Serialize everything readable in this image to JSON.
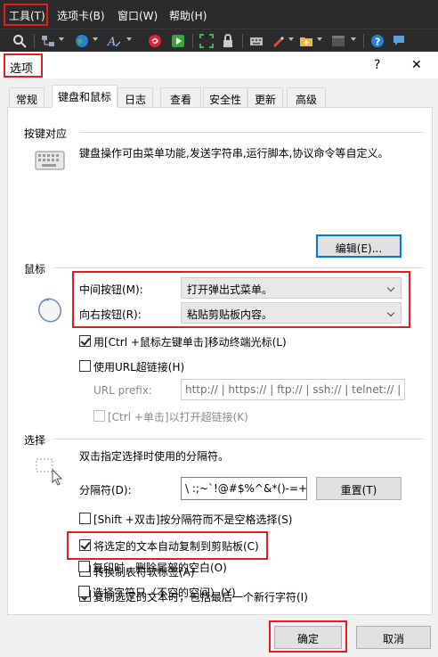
{
  "menubar": {
    "items": [
      "工具(T)",
      "选项卡(B)",
      "窗口(W)",
      "帮助(H)"
    ]
  },
  "toolbar": {
    "icons": [
      "search-icon",
      "network-icon",
      "globe-icon",
      "font-icon",
      "swirl-icon",
      "play-icon",
      "expand-icon",
      "lock-icon",
      "keyboard-icon",
      "pen-icon",
      "add-folder-icon",
      "window-icon",
      "help-icon",
      "chat-icon"
    ]
  },
  "dialog": {
    "title": "选项",
    "help": "?",
    "close": "✕",
    "tabs": [
      "常规",
      "键盘和鼠标",
      "日志",
      "查看",
      "安全性",
      "更新",
      "高级"
    ],
    "active_tab": "键盘和鼠标",
    "keymap": {
      "group": "按键对应",
      "desc": "键盘操作可由菜单功能,发送字符串,运行脚本,协议命令等自定义。",
      "edit_button": "编辑(E)..."
    },
    "mouse": {
      "group": "鼠标",
      "middle_label": "中间按钮(M):",
      "middle_value": "打开弹出式菜单。",
      "right_label": "向右按钮(R):",
      "right_value": "粘贴剪贴板内容。",
      "ctrl_click": "用[Ctrl +鼠标左键单击]移动终端光标(L)",
      "ctrl_click_checked": true,
      "use_url": "使用URL超链接(H)",
      "use_url_checked": false,
      "url_prefix_label": "URL prefix:",
      "url_prefix_value": "http:// | https:// | ftp:// | ssh:// | telnet:// |",
      "ctrl_open": "[Ctrl +单击]以打开超链接(K)",
      "ctrl_open_checked": false
    },
    "selection": {
      "group": "选择",
      "desc": "双击指定选择时使用的分隔符。",
      "delim_label": "分隔符(D):",
      "delim_value": "\\ :;~`!@#$%^&*()-=+|[",
      "reset_button": "重置(T)",
      "options": [
        {
          "label": "[Shift +双击]按分隔符而不是空格选择(S)",
          "checked": false
        },
        {
          "label": "将选定的文本自动复制到剪贴板(C)",
          "checked": true
        },
        {
          "label": "转换制表符软标签(A)",
          "checked": false
        },
        {
          "label": "复制选定的文本时，包括最后一个新行字符(I)",
          "checked": true
        },
        {
          "label": "复印时，删除尾部的空白(O)",
          "checked": false
        },
        {
          "label": "选择字符只（不空的空间）(Y)",
          "checked": false
        }
      ]
    },
    "ok_button": "确定",
    "cancel_button": "取消"
  },
  "colors": {
    "highlight": "#e02020",
    "focus": "#0078d7",
    "dark_bar": "#2b2b2b"
  }
}
